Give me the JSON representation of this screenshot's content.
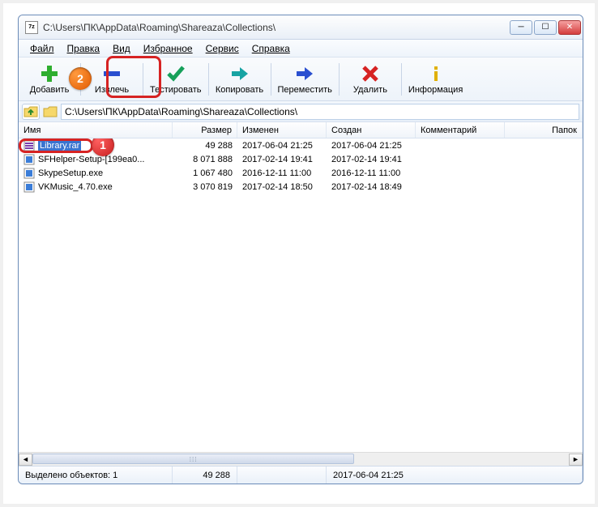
{
  "title": "C:\\Users\\ПК\\AppData\\Roaming\\Shareaza\\Collections\\",
  "app_icon_text": "7z",
  "win_controls": {
    "min": "─",
    "max": "☐",
    "close": "✕"
  },
  "menu": {
    "file": "Файл",
    "edit": "Правка",
    "view": "Вид",
    "fav": "Избранное",
    "tools": "Сервис",
    "help": "Справка"
  },
  "toolbar": {
    "add": "Добавить",
    "extract": "Извлечь",
    "test": "Тестировать",
    "copy": "Копировать",
    "move": "Переместить",
    "delete": "Удалить",
    "info": "Информация"
  },
  "badges": {
    "one": "1",
    "two": "2"
  },
  "address": {
    "path": "C:\\Users\\ПК\\AppData\\Roaming\\Shareaza\\Collections\\",
    "up_glyph": "↥"
  },
  "columns": {
    "name": "Имя",
    "size": "Размер",
    "modified": "Изменен",
    "created": "Создан",
    "comment": "Комментарий",
    "folders": "Папок"
  },
  "rows": [
    {
      "name": "Library.rar",
      "size": "49 288",
      "mod": "2017-06-04 21:25",
      "cre": "2017-06-04 21:25",
      "selected": true,
      "type": "rar"
    },
    {
      "name": "SFHelper-Setup-[199ea0...",
      "size": "8 071 888",
      "mod": "2017-02-14 19:41",
      "cre": "2017-02-14 19:41",
      "selected": false,
      "type": "exe"
    },
    {
      "name": "SkypeSetup.exe",
      "size": "1 067 480",
      "mod": "2016-12-11 11:00",
      "cre": "2016-12-11 11:00",
      "selected": false,
      "type": "exe"
    },
    {
      "name": "VKMusic_4.70.exe",
      "size": "3 070 819",
      "mod": "2017-02-14 18:50",
      "cre": "2017-02-14 18:49",
      "selected": false,
      "type": "exe"
    }
  ],
  "scroll": {
    "left": "◄",
    "right": "►",
    "grip": "⁞⁞⁞"
  },
  "status": {
    "selected_label": "Выделено объектов: 1",
    "size": "49 288",
    "date": "2017-06-04 21:25"
  }
}
